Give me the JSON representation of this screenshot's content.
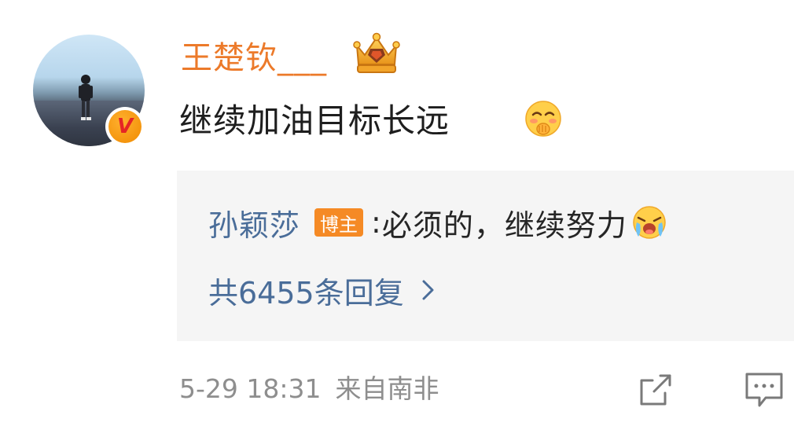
{
  "comment": {
    "author": "王楚钦___",
    "author_color": "#ec7a2a",
    "crown_icon": "gold-crown-icon",
    "verified_badge_letter": "V",
    "text": "继续加油目标长远",
    "emoji": "shy-face-emoji"
  },
  "reply": {
    "author": "孙颖莎",
    "badge": "博主",
    "separator": ":",
    "text": "必须的，继续努力",
    "emoji": "crying-face-emoji",
    "count_text": "共6455条回复"
  },
  "meta": {
    "date": "5-29 18:31",
    "source": "来自南非"
  },
  "actions": {
    "share_icon": "share-icon",
    "comment_icon": "comment-icon"
  },
  "colors": {
    "link_blue": "#4a6d99",
    "badge_orange": "#f58a25",
    "meta_gray": "#8e8e8e",
    "reply_bg": "#f5f5f5"
  }
}
